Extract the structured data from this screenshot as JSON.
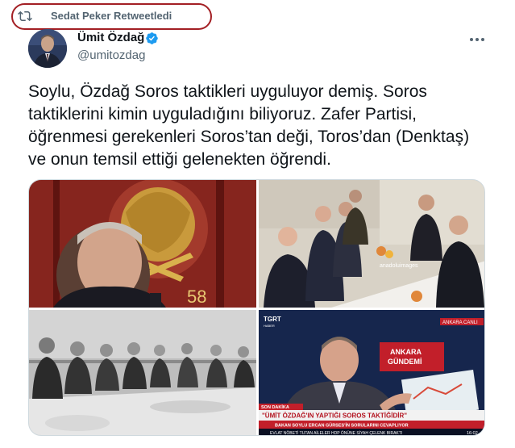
{
  "retweet": {
    "label": "Sedat Peker Retweetledi",
    "icon": "retweet-icon",
    "highlight_color": "#a31f24"
  },
  "author": {
    "name": "Ümit Özdağ",
    "handle": "@umitozdag",
    "verified_icon": "verified-badge-icon",
    "badge_color": "#1d9bf0"
  },
  "menu": {
    "icon": "more-horizontal-icon"
  },
  "tweet": {
    "text": "Soylu, Özdağ Soros taktikleri uyguluyor demiş. Soros taktiklerini kimin uyguladığını biliyoruz. Zafer Partisi, öğrenmesi gerekenleri Soros’tan deği, Toros’dan (Denktaş) ve onun temsil ettiği gelenekten öğrendi."
  },
  "media": {
    "photo1": {
      "overlay_text": "58"
    },
    "photo2": {
      "watermark": "anadoluimages"
    },
    "photo4": {
      "channel": "TGRT",
      "channel_sub": "HABER",
      "live_tag": "ANKARA  CANLI",
      "studio_sign": "ANKARA\nGÜNDEMİ",
      "breaking_label": "SON DAKİKA",
      "headline": "\"ÜMİT ÖZDAĞ'IN YAPTIĞI SOROS TAKTİĞİDİR\"",
      "subheadline": "BAKAN SOYLU ERCAN GÜRSES'İN SORULARINI CEVAPLIYOR",
      "ticker": "EVLAT NÖBETİ TUTAN AİLELER HDP ÖNÜNE SİYAH ÇELENK BIRAKTI",
      "clock": "16:02"
    }
  }
}
